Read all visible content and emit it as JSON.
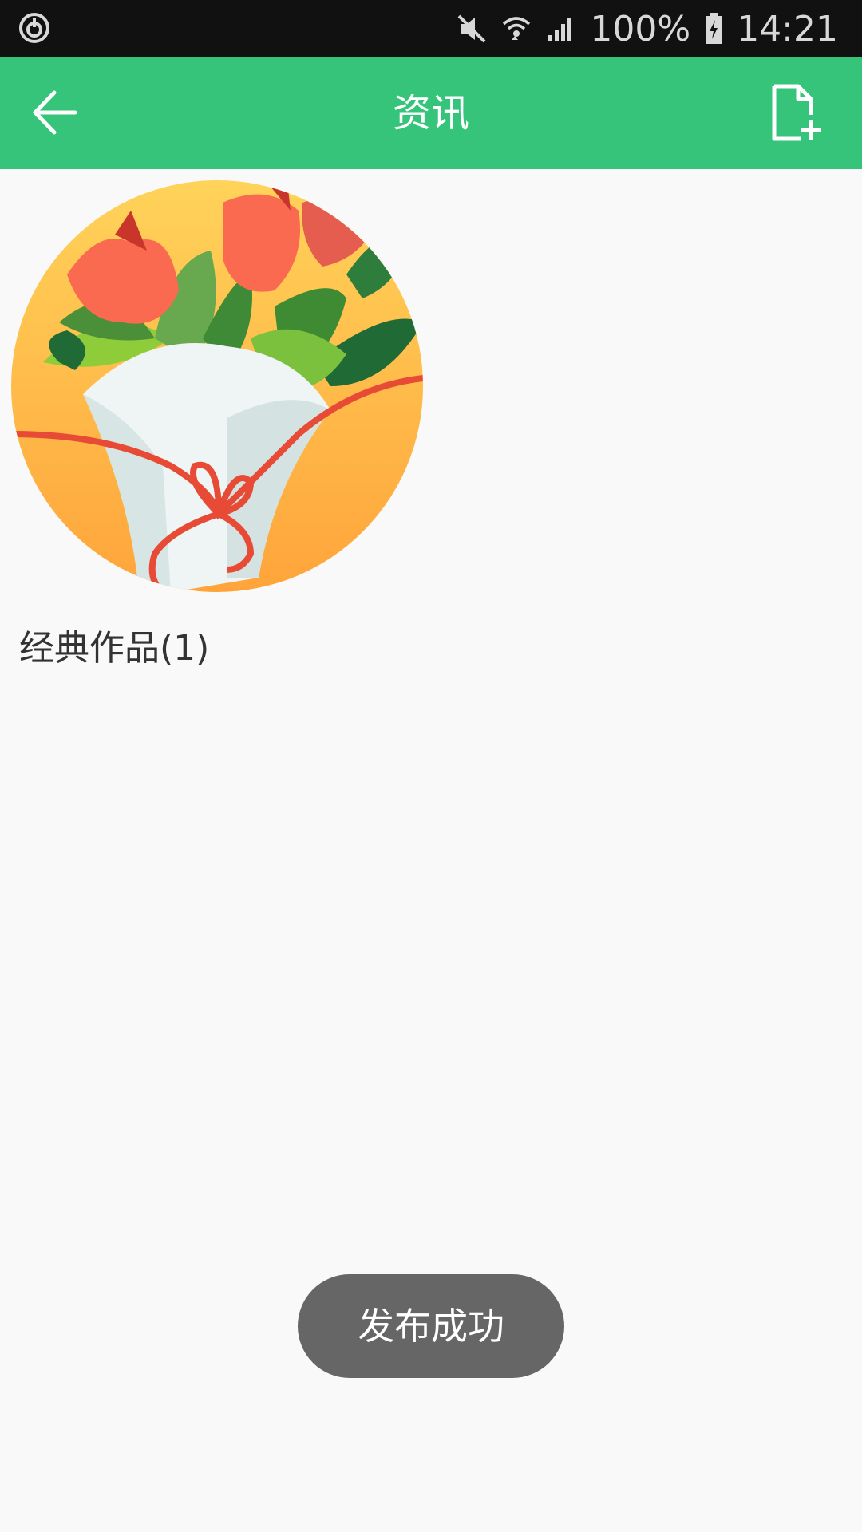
{
  "status_bar": {
    "battery": "100%",
    "time": "14:21",
    "icons": [
      "sync-icon",
      "mute-icon",
      "wifi-icon",
      "signal-icon",
      "battery-charging-icon"
    ]
  },
  "app_bar": {
    "title": "资讯",
    "back_icon": "back-arrow-icon",
    "action_icon": "new-document-icon",
    "color": "#35c47a"
  },
  "content": {
    "items": [
      {
        "label": "经典作品(1)",
        "image": "flower-bouquet"
      }
    ]
  },
  "toast": {
    "message": "发布成功"
  }
}
